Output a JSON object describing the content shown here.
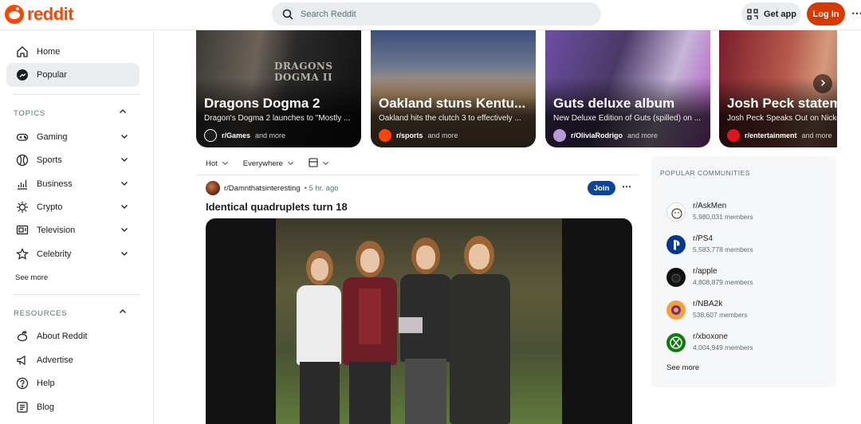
{
  "header": {
    "logo_text": "reddit",
    "search_placeholder": "Search Reddit",
    "get_app_label": "Get app",
    "login_label": "Log In",
    "more_label": "⋯"
  },
  "sidebar": {
    "home": "Home",
    "popular": "Popular",
    "topics_heading": "TOPICS",
    "topics": [
      "Gaming",
      "Sports",
      "Business",
      "Crypto",
      "Television",
      "Celebrity"
    ],
    "topics_see_more": "See more",
    "resources_heading": "RESOURCES",
    "resources": [
      "About Reddit",
      "Advertise",
      "Help",
      "Blog"
    ]
  },
  "carousel": [
    {
      "title": "Dragons Dogma 2",
      "desc": "Dragon's Dogma 2 launches to \"Mostly ...",
      "sub": "r/Games",
      "suffix": "and more",
      "image_text": "DRAGONS DOGMA II"
    },
    {
      "title": "Oakland stuns Kentu...",
      "desc": "Oakland hits the clutch 3 to effectively ...",
      "sub": "r/sports",
      "suffix": "and more"
    },
    {
      "title": "Guts deluxe album",
      "desc": "New Deluxe Edition of Guts (spilled) on ...",
      "sub": "r/OliviaRodrigo",
      "suffix": "and more"
    },
    {
      "title": "Josh Peck statem",
      "desc": "Josh Peck Speaks Out on Nicke",
      "sub": "r/entertainment",
      "suffix": "and more"
    }
  ],
  "feed": {
    "sort": "Hot",
    "location": "Everywhere",
    "post": {
      "subreddit": "r/Damnthatsinteresting",
      "time": "• 5 hr. ago",
      "join_label": "Join",
      "more": "⋯",
      "title": "Identical quadruplets turn 18"
    }
  },
  "popular_communities": {
    "heading": "POPULAR COMMUNITIES",
    "items": [
      {
        "name": "r/AskMen",
        "members": "5,980,031 members"
      },
      {
        "name": "r/PS4",
        "members": "5,583,778 members"
      },
      {
        "name": "r/apple",
        "members": "4,808,879 members"
      },
      {
        "name": "r/NBA2k",
        "members": "538,607 members"
      },
      {
        "name": "r/xboxone",
        "members": "4,004,949 members"
      }
    ],
    "see_more": "See more"
  },
  "colors": {
    "brand": "#ff4500",
    "login": "#d93900",
    "join": "#0a449b"
  }
}
